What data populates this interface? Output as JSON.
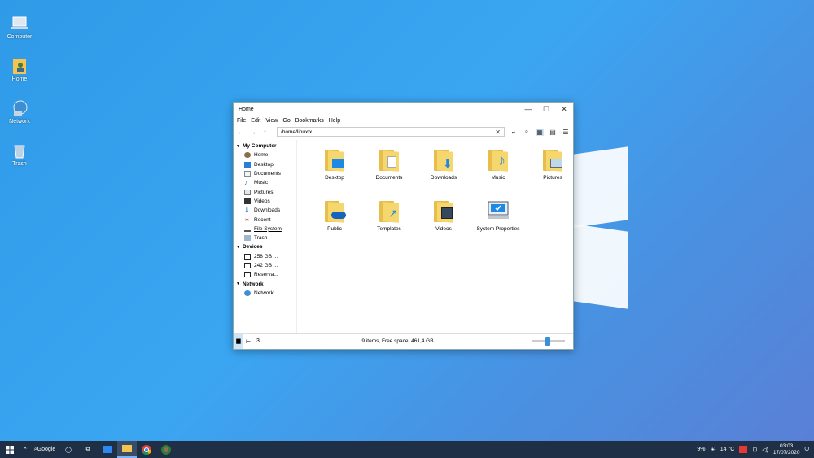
{
  "desktop": {
    "icons": [
      {
        "label": "Computer"
      },
      {
        "label": "Home"
      },
      {
        "label": "Network"
      },
      {
        "label": "Trash"
      }
    ]
  },
  "window": {
    "title": "Home",
    "menu": [
      "File",
      "Edit",
      "View",
      "Go",
      "Bookmarks",
      "Help"
    ],
    "path": "/home/linuxfx",
    "sidebar": {
      "my_computer": "My Computer",
      "items": [
        "Home",
        "Desktop",
        "Documents",
        "Music",
        "Pictures",
        "Videos",
        "Downloads",
        "Recent",
        "File System",
        "Trash"
      ],
      "devices": "Devices",
      "device_items": [
        "258 GB ...",
        "242 GB ...",
        "Reserva..."
      ],
      "network": "Network",
      "network_items": [
        "Network"
      ]
    },
    "files": [
      "Desktop",
      "Documents",
      "Downloads",
      "Music",
      "Pictures",
      "Public",
      "Templates",
      "Videos",
      "System Properties"
    ],
    "status": "9 items, Free space: 461,4 GB",
    "statusbar_num": "3"
  },
  "taskbar": {
    "search_label": "Google",
    "battery": "9%",
    "weather": "14 °C",
    "time": "03:03",
    "date": "17/07/2020"
  },
  "colors": {
    "folder": "#f5d76e",
    "accent": "#3b8fd6",
    "taskbar": "#1f2f45"
  }
}
